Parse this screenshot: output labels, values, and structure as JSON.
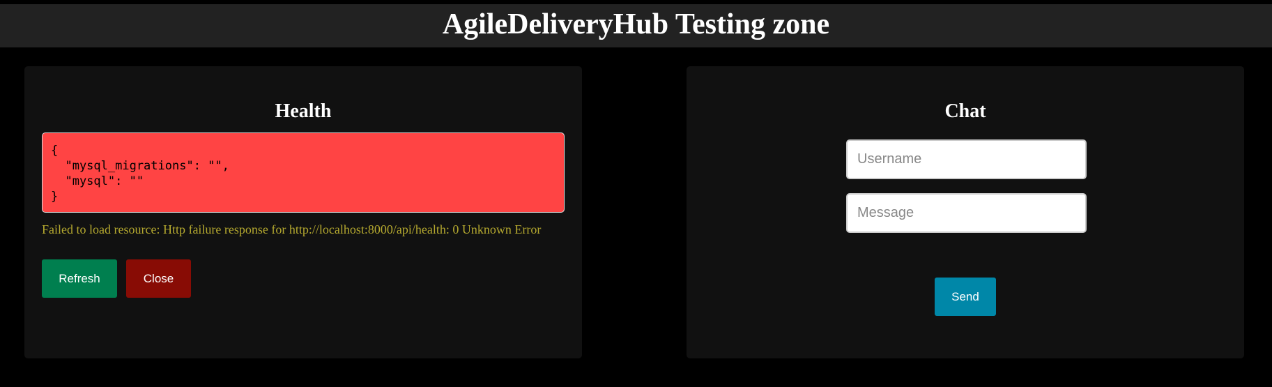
{
  "header": {
    "title": "AgileDeliveryHub Testing zone"
  },
  "health": {
    "title": "Health",
    "json_text": "{\n  \"mysql_migrations\": \"\",\n  \"mysql\": \"\"\n}",
    "error_message": "Failed to load resource: Http failure response for http://localhost:8000/api/health: 0 Unknown Error",
    "refresh_label": "Refresh",
    "close_label": "Close"
  },
  "chat": {
    "title": "Chat",
    "username_placeholder": "Username",
    "username_value": "",
    "message_placeholder": "Message",
    "message_value": "",
    "send_label": "Send"
  },
  "colors": {
    "background": "#000000",
    "header_bg": "#222222",
    "panel_bg": "#111111",
    "json_box_bg": "#ff4444",
    "error_text": "#b5a92f",
    "refresh_button": "#007f4f",
    "close_button": "#880c05",
    "send_button": "#0087a8"
  }
}
